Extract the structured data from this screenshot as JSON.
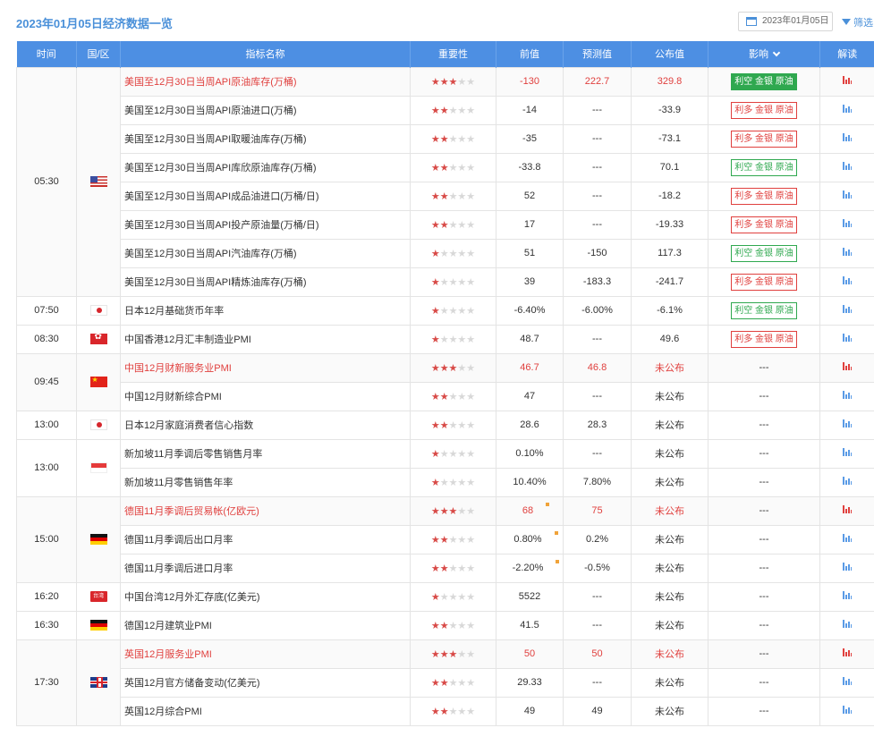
{
  "header": {
    "title": "2023年01月05日经济数据一览",
    "date": "2023年01月05日",
    "filter_label": "筛选"
  },
  "columns": {
    "time": "时间",
    "region": "国/区",
    "name": "指标名称",
    "importance": "重要性",
    "previous": "前值",
    "forecast": "预测值",
    "actual": "公布值",
    "impact": "影响",
    "analysis": "解读"
  },
  "colors": {
    "header_bg": "#4d8fe3",
    "highlight_red": "#e0403e",
    "bear_green": "#2fa84f",
    "accent_blue": "#4a90d9"
  },
  "groups": [
    {
      "time": "05:30",
      "flag": "us-flag",
      "rows": [
        {
          "name": "美国至12月30日当周API原油库存(万桶)",
          "stars": 3,
          "previous": "-130",
          "forecast": "222.7",
          "actual": "329.8",
          "impact": "利空 金银 原油",
          "impact_type": "bear-solid",
          "highlight": true
        },
        {
          "name": "美国至12月30日当周API原油进口(万桶)",
          "stars": 2,
          "previous": "-14",
          "forecast": "---",
          "actual": "-33.9",
          "impact": "利多 金银 原油",
          "impact_type": "bull"
        },
        {
          "name": "美国至12月30日当周API取暖油库存(万桶)",
          "stars": 2,
          "previous": "-35",
          "forecast": "---",
          "actual": "-73.1",
          "impact": "利多 金银 原油",
          "impact_type": "bull"
        },
        {
          "name": "美国至12月30日当周API库欣原油库存(万桶)",
          "stars": 2,
          "previous": "-33.8",
          "forecast": "---",
          "actual": "70.1",
          "impact": "利空 金银 原油",
          "impact_type": "bear"
        },
        {
          "name": "美国至12月30日当周API成品油进口(万桶/日)",
          "stars": 2,
          "previous": "52",
          "forecast": "---",
          "actual": "-18.2",
          "impact": "利多 金银 原油",
          "impact_type": "bull"
        },
        {
          "name": "美国至12月30日当周API投产原油量(万桶/日)",
          "stars": 2,
          "previous": "17",
          "forecast": "---",
          "actual": "-19.33",
          "impact": "利多 金银 原油",
          "impact_type": "bull"
        },
        {
          "name": "美国至12月30日当周API汽油库存(万桶)",
          "stars": 1,
          "previous": "51",
          "forecast": "-150",
          "actual": "117.3",
          "impact": "利空 金银 原油",
          "impact_type": "bear"
        },
        {
          "name": "美国至12月30日当周API精炼油库存(万桶)",
          "stars": 1,
          "previous": "39",
          "forecast": "-183.3",
          "actual": "-241.7",
          "impact": "利多 金银 原油",
          "impact_type": "bull"
        }
      ]
    },
    {
      "time": "07:50",
      "flag": "jp-flag",
      "rows": [
        {
          "name": "日本12月基础货币年率",
          "stars": 1,
          "previous": "-6.40%",
          "forecast": "-6.00%",
          "actual": "-6.1%",
          "impact": "利空 金银 原油",
          "impact_type": "bear"
        }
      ]
    },
    {
      "time": "08:30",
      "flag": "hk-flag",
      "rows": [
        {
          "name": "中国香港12月汇丰制造业PMI",
          "stars": 1,
          "previous": "48.7",
          "forecast": "---",
          "actual": "49.6",
          "impact": "利多 金银 原油",
          "impact_type": "bull"
        }
      ]
    },
    {
      "time": "09:45",
      "flag": "cn-flag",
      "rows": [
        {
          "name": "中国12月财新服务业PMI",
          "stars": 3,
          "previous": "46.7",
          "forecast": "46.8",
          "actual": "未公布",
          "impact": "---",
          "impact_type": "none",
          "highlight": true
        },
        {
          "name": "中国12月财新综合PMI",
          "stars": 2,
          "previous": "47",
          "forecast": "---",
          "actual": "未公布",
          "impact": "---",
          "impact_type": "none"
        }
      ]
    },
    {
      "time": "13:00",
      "flag": "jp-flag",
      "rows": [
        {
          "name": "日本12月家庭消费者信心指数",
          "stars": 2,
          "previous": "28.6",
          "forecast": "28.3",
          "actual": "未公布",
          "impact": "---",
          "impact_type": "none"
        }
      ]
    },
    {
      "time": "13:00",
      "flag": "sg-flag",
      "rows": [
        {
          "name": "新加坡11月季调后零售销售月率",
          "stars": 1,
          "previous": "0.10%",
          "forecast": "---",
          "actual": "未公布",
          "impact": "---",
          "impact_type": "none"
        },
        {
          "name": "新加坡11月零售销售年率",
          "stars": 1,
          "previous": "10.40%",
          "forecast": "7.80%",
          "actual": "未公布",
          "impact": "---",
          "impact_type": "none"
        }
      ]
    },
    {
      "time": "15:00",
      "flag": "de-flag",
      "rows": [
        {
          "name": "德国11月季调后贸易帐(亿欧元)",
          "stars": 3,
          "previous": "68",
          "forecast": "75",
          "actual": "未公布",
          "impact": "---",
          "impact_type": "none",
          "highlight": true,
          "revised": true
        },
        {
          "name": "德国11月季调后出口月率",
          "stars": 2,
          "previous": "0.80%",
          "forecast": "0.2%",
          "actual": "未公布",
          "impact": "---",
          "impact_type": "none",
          "revised": true
        },
        {
          "name": "德国11月季调后进口月率",
          "stars": 2,
          "previous": "-2.20%",
          "forecast": "-0.5%",
          "actual": "未公布",
          "impact": "---",
          "impact_type": "none",
          "revised": true
        }
      ]
    },
    {
      "time": "16:20",
      "flag": "tw-flag",
      "flag_text": "台湾",
      "rows": [
        {
          "name": "中国台湾12月外汇存底(亿美元)",
          "stars": 1,
          "previous": "5522",
          "forecast": "---",
          "actual": "未公布",
          "impact": "---",
          "impact_type": "none"
        }
      ]
    },
    {
      "time": "16:30",
      "flag": "de-flag",
      "rows": [
        {
          "name": "德国12月建筑业PMI",
          "stars": 2,
          "previous": "41.5",
          "forecast": "---",
          "actual": "未公布",
          "impact": "---",
          "impact_type": "none"
        }
      ]
    },
    {
      "time": "17:30",
      "flag": "gb-flag",
      "rows": [
        {
          "name": "英国12月服务业PMI",
          "stars": 3,
          "previous": "50",
          "forecast": "50",
          "actual": "未公布",
          "impact": "---",
          "impact_type": "none",
          "highlight": true
        },
        {
          "name": "英国12月官方储备变动(亿美元)",
          "stars": 2,
          "previous": "29.33",
          "forecast": "---",
          "actual": "未公布",
          "impact": "---",
          "impact_type": "none"
        },
        {
          "name": "英国12月综合PMI",
          "stars": 2,
          "previous": "49",
          "forecast": "49",
          "actual": "未公布",
          "impact": "---",
          "impact_type": "none"
        }
      ]
    }
  ]
}
